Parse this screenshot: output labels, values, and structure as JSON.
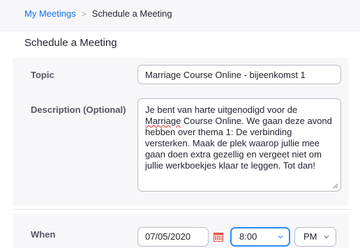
{
  "breadcrumb": {
    "link": "My Meetings",
    "separator": ">",
    "current": "Schedule a Meeting"
  },
  "page_title": "Schedule a Meeting",
  "form": {
    "topic": {
      "label": "Topic",
      "value": "Marriage Course Online - bijeenkomst 1"
    },
    "description": {
      "label": "Description (Optional)",
      "text_before": "Je bent van harte uitgenodigd voor de ",
      "flagged_word": "Marriage",
      "text_after": " Course Online. We gaan deze avond hebben over thema 1: De verbinding versterken. Maak de plek waarop jullie mee gaan doen extra gezellig en vergeet niet om jullie werkboekjes klaar te leggen. Tot dan!"
    },
    "when": {
      "label": "When",
      "date": "07/05/2020",
      "time": "8:00",
      "meridiem": "PM"
    }
  },
  "colors": {
    "link": "#0e72ed",
    "focus_border": "#2d8cff",
    "calendar_icon": "#e8534f",
    "spell_underline": "#e02828"
  },
  "icons": {
    "calendar": "calendar-icon",
    "chevron": "chevron-down-icon"
  }
}
